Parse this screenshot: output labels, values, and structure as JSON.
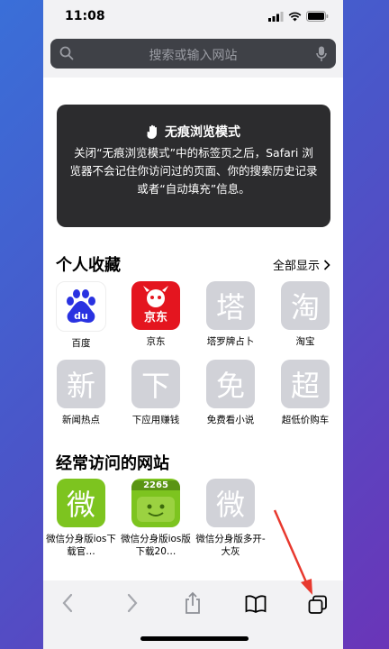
{
  "status_bar": {
    "time": "11:08"
  },
  "address_bar": {
    "placeholder": "搜索或输入网站"
  },
  "private_card": {
    "title": "无痕浏览模式",
    "description": "关闭“无痕浏览模式”中的标签页之后，Safari 浏览器不会记住你访问过的页面、你的搜索历史记录或者“自动填充”信息。"
  },
  "favorites": {
    "title": "个人收藏",
    "show_all": "全部显示",
    "items": [
      {
        "label": "百度",
        "icon": "baidu-logo"
      },
      {
        "label": "京东",
        "icon": "jd-logo",
        "text": "京东"
      },
      {
        "label": "塔罗牌占卜",
        "glyph": "塔"
      },
      {
        "label": "淘宝",
        "glyph": "淘"
      },
      {
        "label": "新闻热点",
        "glyph": "新"
      },
      {
        "label": "下应用赚钱",
        "glyph": "下"
      },
      {
        "label": "免费看小说",
        "glyph": "免"
      },
      {
        "label": "超低价购车",
        "glyph": "超"
      }
    ]
  },
  "frequent": {
    "title": "经常访问的网站",
    "items": [
      {
        "label": "微信分身版ios下载官…",
        "glyph": "微",
        "color": "#7dc41f"
      },
      {
        "label": "微信分身版ios版下载20…",
        "badge": "2265",
        "color": "#7dc41f"
      },
      {
        "label": "微信分身版多开-大灰",
        "glyph": "微",
        "color": "#d1d2d8"
      }
    ]
  },
  "toolbar": {
    "items": [
      "back-icon",
      "forward-icon",
      "share-icon",
      "bookmarks-icon",
      "tabs-icon"
    ]
  },
  "colors": {
    "accent_arrow": "#e8392e",
    "jd_red": "#e4151f",
    "baidu_blue": "#2932e1"
  }
}
